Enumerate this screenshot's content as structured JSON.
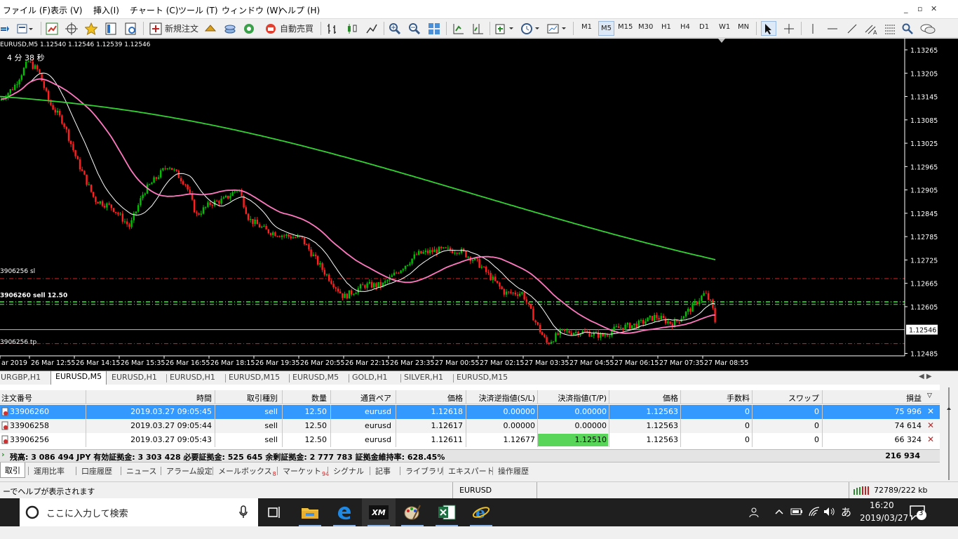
{
  "menu": {
    "items": [
      "ファイル (F)",
      "表示 (V)",
      "挿入(I)",
      "チャート (C)",
      "ツール (T)",
      "ウィンドウ (W)",
      "ヘルプ (H)"
    ]
  },
  "window": {
    "minimize": "_",
    "restore": "▫",
    "close": "✕"
  },
  "toolbar": {
    "new_order": "新規注文",
    "auto_trade": "自動売買",
    "timeframes": [
      "M1",
      "M5",
      "M15",
      "M30",
      "H1",
      "H4",
      "D1",
      "W1",
      "MN"
    ],
    "active_timeframe": "M5"
  },
  "chart": {
    "header": "EURUSD,M5  1.12540 1.12546 1.12539 1.12546",
    "countdown": "4 分 38 秒",
    "price_labels": [
      "1.13265",
      "1.13205",
      "1.13145",
      "1.13085",
      "1.13025",
      "1.12965",
      "1.12905",
      "1.12845",
      "1.12785",
      "1.12725",
      "1.12665",
      "1.12605",
      "1.12546",
      "1.12485"
    ],
    "current_price": "1.12546",
    "time_labels": [
      "ar 2019",
      "26 Mar 12:55",
      "26 Mar 14:15",
      "26 Mar 15:35",
      "26 Mar 16:55",
      "26 Mar 18:15",
      "26 Mar 19:35",
      "26 Mar 20:55",
      "26 Mar 22:15",
      "26 Mar 23:35",
      "27 Mar 00:55",
      "27 Mar 02:15",
      "27 Mar 03:35",
      "27 Mar 04:55",
      "27 Mar 06:15",
      "27 Mar 07:35",
      "27 Mar 08:55"
    ],
    "line_labels": {
      "sl": "3906256 sl",
      "orders": "3906260 sell 12.50",
      "tp": "3906256 tp"
    },
    "colors": {
      "bull": "#00c000",
      "bear": "#ff2020",
      "ma_fast": "#ffffff",
      "ma_mid": "#ff79c0",
      "ma_slow": "#32d232",
      "sl_line": "#e02020",
      "order_line": "#20d020"
    }
  },
  "chart_tabs": {
    "items": [
      "URGBP,H1",
      "EURUSD,M5",
      "EURUSD,H1",
      "EURUSD,H1",
      "EURUSD,M15",
      "EURUSD,M5",
      "GOLD,H1",
      "SILVER,H1",
      "EURUSD,M15"
    ],
    "active_index": 1
  },
  "terminal": {
    "headers": [
      "注文番号",
      "時間",
      "取引種別",
      "数量",
      "通貨ペア",
      "価格",
      "決済逆指値(S/L)",
      "決済指値(T/P)",
      "価格",
      "手数料",
      "スワップ",
      "損益"
    ],
    "sort_icon": "▽",
    "rows": [
      [
        "33906260",
        "2019.03.27 09:05:45",
        "sell",
        "12.50",
        "eurusd",
        "1.12618",
        "0.00000",
        "0.00000",
        "1.12563",
        "0",
        "0",
        "75 996"
      ],
      [
        "33906258",
        "2019.03.27 09:05:44",
        "sell",
        "12.50",
        "eurusd",
        "1.12617",
        "0.00000",
        "0.00000",
        "1.12563",
        "0",
        "0",
        "74 614"
      ],
      [
        "33906256",
        "2019.03.27 09:05:43",
        "sell",
        "12.50",
        "eurusd",
        "1.12611",
        "1.12677",
        "1.12510",
        "1.12563",
        "0",
        "0",
        "66 324"
      ]
    ],
    "balance_line": "残高: 3 086 494 JPY  有効証拠金: 3 303 428  必要証拠金: 525 645  余剰証拠金: 2 777 783  証拠金維持率: 628.45%",
    "total_profit": "216 934",
    "close_mark": "✕"
  },
  "bottom_tabs": {
    "items": [
      "取引",
      "運用比率",
      "口座履歴",
      "ニュース",
      "アラーム設定",
      "メールボックス",
      "マーケット",
      "シグナル",
      "記事",
      "ライブラリ",
      "エキスパート",
      "操作履歴"
    ],
    "mailbox_badge": "8",
    "market_badge": "94"
  },
  "status": {
    "help": "ーでヘルプが表示されます",
    "symbol": "EURUSD",
    "traffic": "72789/222 kb"
  },
  "taskbar": {
    "search_placeholder": "ここに入力して検索",
    "time": "16:20",
    "date": "2019/03/27",
    "ime": "あ",
    "notifications": "3",
    "xm_label": "XM"
  }
}
